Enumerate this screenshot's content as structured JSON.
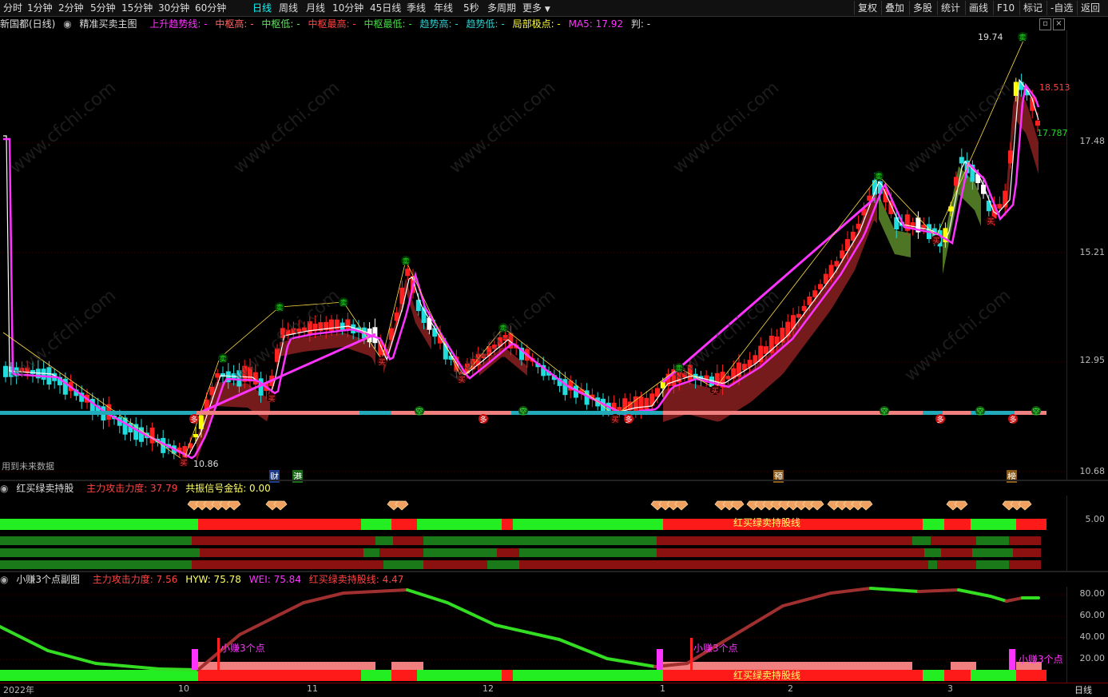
{
  "toolbar": {
    "periods": [
      "分时",
      "1分钟",
      "2分钟",
      "5分钟",
      "15分钟",
      "30分钟",
      "60分钟",
      "日线",
      "周线",
      "月线",
      "10分钟",
      "45日线",
      "季线",
      "年线",
      "5秒",
      "多周期",
      "更多"
    ],
    "active_period": "日线",
    "right_buttons": [
      "复权",
      "叠加",
      "多股",
      "统计",
      "画线",
      "F10",
      "标记",
      "-自选",
      "返回"
    ]
  },
  "main_panel": {
    "stock": "新国都(日线)",
    "indicator": "精准买卖主图",
    "legend": [
      {
        "text": "上升趋势线: -",
        "color": "#ff33ff"
      },
      {
        "text": "中枢高: -",
        "color": "#ff6666"
      },
      {
        "text": "中枢低: -",
        "color": "#66dd66"
      },
      {
        "text": "中枢最高: -",
        "color": "#ff4444"
      },
      {
        "text": "中枢最低: -",
        "color": "#44dd44"
      },
      {
        "text": "趋势高: -",
        "color": "#33cccc"
      },
      {
        "text": "趋势低: -",
        "color": "#33cccc"
      },
      {
        "text": "局部极点: -",
        "color": "#ffff33"
      },
      {
        "text": "MA5: 17.92",
        "color": "#ff33ff"
      },
      {
        "text": "判: -",
        "color": "#dddddd"
      }
    ],
    "y_ticks": [
      "17.48",
      "15.21",
      "12.95",
      "10.68"
    ],
    "price_labels": {
      "high": "19.74",
      "low": "10.86",
      "upper": "18.513",
      "lower": "17.787"
    },
    "future_note": "用到未来数据",
    "markers": {
      "sell": "卖",
      "buy": "买",
      "long": "多",
      "short": "空"
    },
    "bottom_tags": [
      "财",
      "港",
      "预",
      "榜"
    ]
  },
  "panel2": {
    "indicator": "红买绿卖持股",
    "legend": [
      {
        "text": "主力攻击力度: 37.79",
        "color": "#ff4444"
      },
      {
        "text": "共振信号金钻: 0.00",
        "color": "#ffff66"
      }
    ],
    "y_tick": "5.00",
    "band_label": "红买绿卖持股线"
  },
  "panel3": {
    "indicator": "小赚3个点副图",
    "legend": [
      {
        "text": "主力攻击力度: 7.56",
        "color": "#ff4444"
      },
      {
        "text": "HYW: 75.78",
        "color": "#ffff66"
      },
      {
        "text": "WEI: 75.84",
        "color": "#ff33ff"
      },
      {
        "text": "红买绿卖持股线: 4.47",
        "color": "#ff4444"
      }
    ],
    "y_ticks": [
      "80.00",
      "60.00",
      "40.00",
      "20.00"
    ],
    "signal_label": "小赚3个点",
    "band_label": "红买绿卖持股线"
  },
  "x_axis": {
    "labels": [
      "2022年",
      "10",
      "11",
      "12",
      "1",
      "2",
      "3"
    ],
    "period": "日线"
  },
  "watermark": "www.cfchi.com",
  "colors": {
    "up": "#ff2020",
    "down": "#22dddd",
    "ma5": "#ff33ff",
    "green_band": "#22ee22",
    "red_band": "#ff1a1a"
  }
}
